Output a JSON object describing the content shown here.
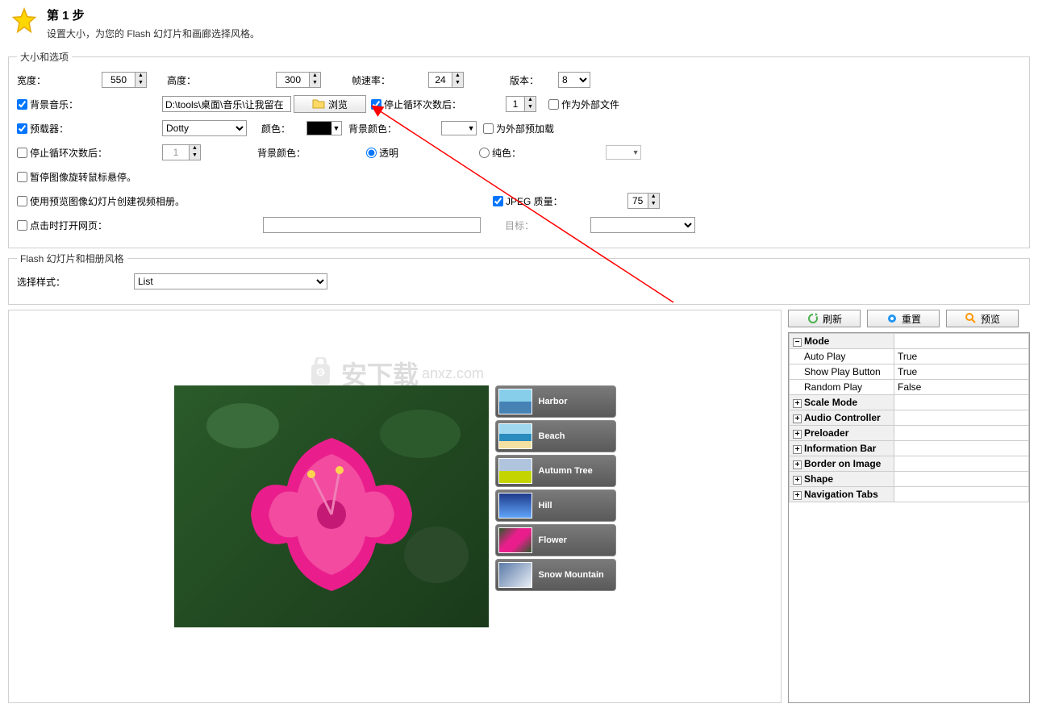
{
  "header": {
    "title": "第 1 步",
    "subtitle": "设置大小，为您的 Flash 幻灯片和画廊选择风格。"
  },
  "fieldset_size": {
    "legend": "大小和选项",
    "width_label": "宽度：",
    "width_value": "550",
    "height_label": "高度：",
    "height_value": "300",
    "fps_label": "帧速率：",
    "fps_value": "24",
    "version_label": "版本：",
    "version_value": "8",
    "bgmusic_label": "背景音乐：",
    "bgmusic_value": "D:\\tools\\桌面\\音乐\\让我留在",
    "browse_label": "浏览",
    "stoploop_label": "停止循环次数后：",
    "stoploop_value": "1",
    "external_file_label": "作为外部文件",
    "preloader_label": "预载器：",
    "preloader_value": "Dotty",
    "color_label": "颜色：",
    "bgcolor_label": "背景颜色：",
    "external_preload_label": "为外部预加载",
    "stoploop2_label": "停止循环次数后：",
    "stoploop2_value": "1",
    "bgcolor2_label": "背景颜色：",
    "transparent_label": "透明",
    "solid_label": "纯色：",
    "pause_hover_label": "暂停图像旋转鼠标悬停。",
    "use_preview_label": "使用预览图像幻灯片创建视频相册。",
    "jpeg_label": "JPEG 质量：",
    "jpeg_value": "75",
    "click_open_label": "点击时打开网页：",
    "target_label": "目标："
  },
  "fieldset_style": {
    "legend": "Flash 幻灯片和相册风格",
    "select_label": "选择样式：",
    "select_value": "List"
  },
  "buttons": {
    "refresh": "刷新",
    "reset": "重置",
    "preview": "预览"
  },
  "thumbs": [
    {
      "label": "Harbor",
      "cls": "thumb-bg-harbor"
    },
    {
      "label": "Beach",
      "cls": "thumb-bg-beach"
    },
    {
      "label": "Autumn Tree",
      "cls": "thumb-bg-autumn"
    },
    {
      "label": "Hill",
      "cls": "thumb-bg-hill"
    },
    {
      "label": "Flower",
      "cls": "thumb-bg-flower"
    },
    {
      "label": "Snow Mountain",
      "cls": "thumb-bg-snow"
    }
  ],
  "props": {
    "cat_mode": "Mode",
    "auto_play": "Auto Play",
    "auto_play_v": "True",
    "show_play": "Show Play Button",
    "show_play_v": "True",
    "random_play": "Random Play",
    "random_play_v": "False",
    "scale_mode": "Scale Mode",
    "audio": "Audio Controller",
    "preloader": "Preloader",
    "info_bar": "Information Bar",
    "border": "Border on Image",
    "shape": "Shape",
    "nav_tabs": "Navigation Tabs"
  },
  "watermark": "安下载"
}
